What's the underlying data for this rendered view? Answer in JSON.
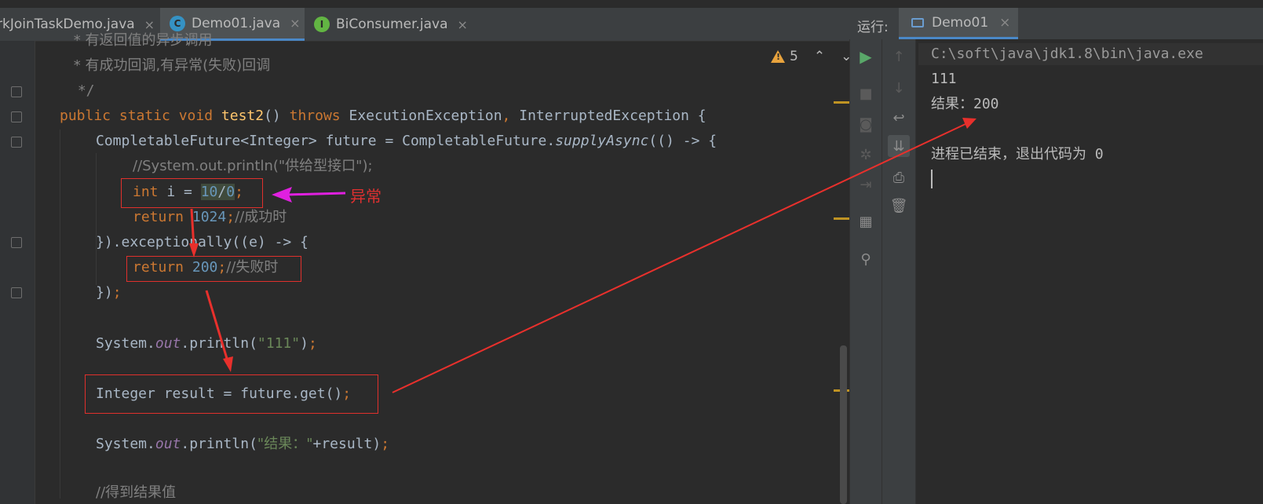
{
  "editor": {
    "tabs": [
      {
        "label": "rkJoinTaskDemo.java",
        "active": false,
        "icon": "none"
      },
      {
        "label": "Demo01.java",
        "active": true,
        "icon": "class-c-icon"
      },
      {
        "label": "BiConsumer.java",
        "active": false,
        "icon": "interface-i-icon"
      }
    ],
    "close_glyph": "×",
    "inspection": {
      "warning_count": "5",
      "up": "⌃",
      "down": "⌄"
    },
    "code": {
      "line0_text": " * 有返回值的异步调用",
      "line1_text": " * 有成功回调,有异常(失败)回调",
      "line2_text": " */",
      "l3_kw1": "public static void ",
      "l3_fn": "test2",
      "l3_mid": "() ",
      "l3_kw2": "throws",
      "l3_rest": " ExecutionException",
      "l3_comma": ",",
      "l3_rest2": " InterruptedException {",
      "l4_a": "CompletableFuture<Integer> future = CompletableFuture.",
      "l4_it": "supplyAsync",
      "l4_b": "(() -> {",
      "l5_comment": "//System.out.println(\"供给型接口\");",
      "l6_kw": "int",
      "l6_mid": " i = ",
      "l6_num1": "10",
      "l6_op": "/",
      "l6_num2": "0",
      "l6_semi": ";",
      "l7_kw": "return ",
      "l7_num": "1024",
      "l7_semi": ";",
      "l7_comment": "//成功时",
      "l8_a": "}).exceptionally((e) -> {",
      "l9_kw": "return ",
      "l9_num": "200",
      "l9_semi": ";",
      "l9_comment": "//失败时",
      "l10_a": "})",
      "l10_semi": ";",
      "l11_a": "System.",
      "l11_field": "out",
      "l11_b": ".println(",
      "l11_str": "\"111\"",
      "l11_c": ")",
      "l11_semi": ";",
      "l12_a": "Integer result = future.get()",
      "l12_semi": ";",
      "l13_a": "System.",
      "l13_field": "out",
      "l13_b": ".println(",
      "l13_str": "\"结果：\"",
      "l13_c": "+result)",
      "l13_semi": ";",
      "l14_comment": "//得到结果值"
    }
  },
  "annotation": {
    "label": "异常"
  },
  "run_panel": {
    "title": "运行:",
    "tab_label": "Demo01",
    "console": {
      "command": "C:\\soft\\java\\jdk1.8\\bin\\java.exe",
      "lines": [
        "111",
        "结果：200",
        "",
        "进程已结束，退出代码为 0"
      ]
    }
  },
  "icons": {
    "run": "run-icon",
    "stop": "stop-icon",
    "camera": "camera-icon",
    "debug": "debug-icon",
    "login": "login-icon",
    "layout": "layout-icon",
    "pin": "pin-icon",
    "up": "up-arrow-icon",
    "down": "down-arrow-icon",
    "wrap": "soft-wrap-icon",
    "scroll-end": "scroll-to-end-icon",
    "print": "print-icon",
    "trash": "trash-icon"
  },
  "colors": {
    "annotation_red": "#e8302c",
    "annotation_magenta": "#e020e0",
    "accent": "#4a88c7",
    "warning": "#e8a33d"
  }
}
